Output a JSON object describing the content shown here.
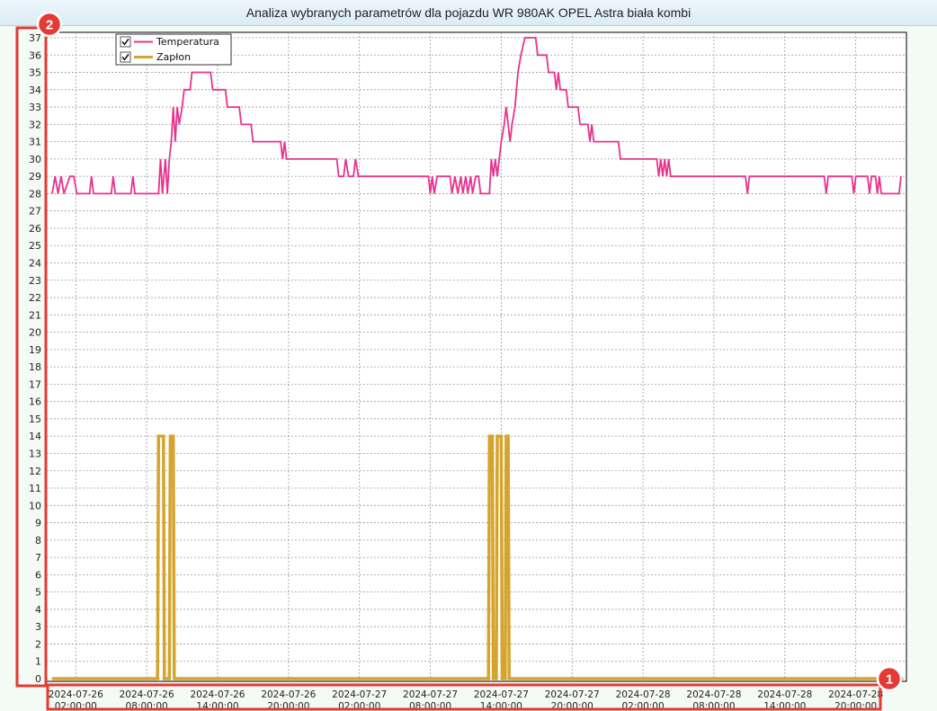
{
  "window": {
    "title": "Analiza wybranych parametrów dla pojazdu WR 980AK OPEL Astra biała kombi"
  },
  "annotations": {
    "x_axis_marker": "1",
    "y_axis_marker": "2"
  },
  "colors": {
    "temperatura": "#e8338f",
    "zaplon": "#d4a42c",
    "marker": "#e53935"
  },
  "chart_data": {
    "type": "line",
    "title": "",
    "xlabel": "",
    "ylabel": "",
    "ylim": [
      0,
      37
    ],
    "y_ticks": [
      0,
      1,
      2,
      3,
      4,
      5,
      6,
      7,
      8,
      9,
      10,
      11,
      12,
      13,
      14,
      15,
      16,
      17,
      18,
      19,
      20,
      21,
      22,
      23,
      24,
      25,
      26,
      27,
      28,
      29,
      30,
      31,
      32,
      33,
      34,
      35,
      36,
      37
    ],
    "x_range": [
      "2024-07-26 00:00:00",
      "2024-07-28 23:59:00"
    ],
    "x_ticks": [
      {
        "date": "2024-07-26",
        "time": "02:00:00"
      },
      {
        "date": "2024-07-26",
        "time": "08:00:00"
      },
      {
        "date": "2024-07-26",
        "time": "14:00:00"
      },
      {
        "date": "2024-07-26",
        "time": "20:00:00"
      },
      {
        "date": "2024-07-27",
        "time": "02:00:00"
      },
      {
        "date": "2024-07-27",
        "time": "08:00:00"
      },
      {
        "date": "2024-07-27",
        "time": "14:00:00"
      },
      {
        "date": "2024-07-27",
        "time": "20:00:00"
      },
      {
        "date": "2024-07-28",
        "time": "02:00:00"
      },
      {
        "date": "2024-07-28",
        "time": "08:00:00"
      },
      {
        "date": "2024-07-28",
        "time": "14:00:00"
      },
      {
        "date": "2024-07-28",
        "time": "20:00:00"
      }
    ],
    "grid": true,
    "legend": "top-left",
    "series": [
      {
        "name": "Temperatura",
        "checked": true,
        "points": [
          [
            "2024-07-26 00:00",
            28
          ],
          [
            "2024-07-26 00:15",
            29
          ],
          [
            "2024-07-26 00:30",
            28
          ],
          [
            "2024-07-26 00:45",
            29
          ],
          [
            "2024-07-26 01:00",
            28
          ],
          [
            "2024-07-26 01:30",
            29
          ],
          [
            "2024-07-26 01:50",
            29
          ],
          [
            "2024-07-26 02:05",
            28
          ],
          [
            "2024-07-26 03:10",
            28
          ],
          [
            "2024-07-26 03:20",
            29
          ],
          [
            "2024-07-26 03:30",
            28
          ],
          [
            "2024-07-26 05:00",
            28
          ],
          [
            "2024-07-26 05:10",
            29
          ],
          [
            "2024-07-26 05:20",
            28
          ],
          [
            "2024-07-26 06:40",
            28
          ],
          [
            "2024-07-26 06:50",
            29
          ],
          [
            "2024-07-26 07:00",
            28
          ],
          [
            "2024-07-26 09:00",
            28
          ],
          [
            "2024-07-26 09:10",
            30
          ],
          [
            "2024-07-26 09:20",
            28
          ],
          [
            "2024-07-26 09:35",
            30
          ],
          [
            "2024-07-26 09:45",
            28
          ],
          [
            "2024-07-26 09:55",
            30
          ],
          [
            "2024-07-26 10:05",
            31
          ],
          [
            "2024-07-26 10:15",
            33
          ],
          [
            "2024-07-26 10:25",
            31
          ],
          [
            "2024-07-26 10:35",
            33
          ],
          [
            "2024-07-26 10:45",
            32
          ],
          [
            "2024-07-26 11:00",
            33
          ],
          [
            "2024-07-26 11:10",
            34
          ],
          [
            "2024-07-26 11:40",
            34
          ],
          [
            "2024-07-26 11:50",
            35
          ],
          [
            "2024-07-26 13:25",
            35
          ],
          [
            "2024-07-26 13:35",
            34
          ],
          [
            "2024-07-26 14:40",
            34
          ],
          [
            "2024-07-26 14:50",
            33
          ],
          [
            "2024-07-26 15:50",
            33
          ],
          [
            "2024-07-26 16:00",
            32
          ],
          [
            "2024-07-26 16:50",
            32
          ],
          [
            "2024-07-26 17:00",
            31
          ],
          [
            "2024-07-26 19:20",
            31
          ],
          [
            "2024-07-26 19:30",
            30
          ],
          [
            "2024-07-26 19:40",
            31
          ],
          [
            "2024-07-26 19:50",
            30
          ],
          [
            "2024-07-27 00:05",
            30
          ],
          [
            "2024-07-27 00:15",
            29
          ],
          [
            "2024-07-27 00:40",
            29
          ],
          [
            "2024-07-27 00:50",
            30
          ],
          [
            "2024-07-27 01:05",
            29
          ],
          [
            "2024-07-27 01:30",
            29
          ],
          [
            "2024-07-27 01:40",
            30
          ],
          [
            "2024-07-27 01:55",
            29
          ],
          [
            "2024-07-27 07:50",
            29
          ],
          [
            "2024-07-27 08:00",
            28
          ],
          [
            "2024-07-27 08:10",
            29
          ],
          [
            "2024-07-27 08:20",
            28
          ],
          [
            "2024-07-27 08:35",
            29
          ],
          [
            "2024-07-27 09:40",
            29
          ],
          [
            "2024-07-27 09:50",
            28
          ],
          [
            "2024-07-27 10:05",
            29
          ],
          [
            "2024-07-27 10:20",
            28
          ],
          [
            "2024-07-27 10:35",
            29
          ],
          [
            "2024-07-27 10:45",
            28
          ],
          [
            "2024-07-27 11:00",
            29
          ],
          [
            "2024-07-27 11:10",
            28
          ],
          [
            "2024-07-27 11:25",
            29
          ],
          [
            "2024-07-27 11:35",
            28
          ],
          [
            "2024-07-27 11:50",
            29
          ],
          [
            "2024-07-27 12:05",
            29
          ],
          [
            "2024-07-27 12:15",
            28
          ],
          [
            "2024-07-27 13:00",
            28
          ],
          [
            "2024-07-27 13:10",
            30
          ],
          [
            "2024-07-27 13:20",
            29
          ],
          [
            "2024-07-27 13:30",
            30
          ],
          [
            "2024-07-27 13:40",
            29
          ],
          [
            "2024-07-27 13:50",
            30
          ],
          [
            "2024-07-27 14:00",
            31
          ],
          [
            "2024-07-27 14:15",
            32
          ],
          [
            "2024-07-27 14:25",
            33
          ],
          [
            "2024-07-27 14:35",
            32
          ],
          [
            "2024-07-27 14:45",
            31
          ],
          [
            "2024-07-27 14:55",
            32
          ],
          [
            "2024-07-27 15:10",
            33
          ],
          [
            "2024-07-27 15:25",
            35
          ],
          [
            "2024-07-27 15:40",
            36
          ],
          [
            "2024-07-27 16:00",
            37
          ],
          [
            "2024-07-27 16:55",
            37
          ],
          [
            "2024-07-27 17:05",
            36
          ],
          [
            "2024-07-27 17:50",
            36
          ],
          [
            "2024-07-27 18:00",
            35
          ],
          [
            "2024-07-27 18:30",
            35
          ],
          [
            "2024-07-27 18:40",
            34
          ],
          [
            "2024-07-27 18:50",
            35
          ],
          [
            "2024-07-27 19:00",
            34
          ],
          [
            "2024-07-27 19:30",
            34
          ],
          [
            "2024-07-27 19:40",
            33
          ],
          [
            "2024-07-27 20:30",
            33
          ],
          [
            "2024-07-27 20:40",
            32
          ],
          [
            "2024-07-27 21:20",
            32
          ],
          [
            "2024-07-27 21:30",
            31
          ],
          [
            "2024-07-27 21:40",
            32
          ],
          [
            "2024-07-27 21:50",
            31
          ],
          [
            "2024-07-27 23:55",
            31
          ],
          [
            "2024-07-28 00:05",
            30
          ],
          [
            "2024-07-28 03:10",
            30
          ],
          [
            "2024-07-28 03:20",
            29
          ],
          [
            "2024-07-28 03:30",
            30
          ],
          [
            "2024-07-28 03:40",
            29
          ],
          [
            "2024-07-28 03:50",
            30
          ],
          [
            "2024-07-28 04:00",
            29
          ],
          [
            "2024-07-28 04:10",
            30
          ],
          [
            "2024-07-28 04:20",
            29
          ],
          [
            "2024-07-28 10:40",
            29
          ],
          [
            "2024-07-28 10:50",
            28
          ],
          [
            "2024-07-28 11:00",
            29
          ],
          [
            "2024-07-28 17:20",
            29
          ],
          [
            "2024-07-28 17:30",
            28
          ],
          [
            "2024-07-28 17:40",
            29
          ],
          [
            "2024-07-28 19:40",
            29
          ],
          [
            "2024-07-28 19:50",
            28
          ],
          [
            "2024-07-28 20:00",
            29
          ],
          [
            "2024-07-28 21:00",
            29
          ],
          [
            "2024-07-28 21:10",
            28
          ],
          [
            "2024-07-28 21:20",
            29
          ],
          [
            "2024-07-28 21:40",
            29
          ],
          [
            "2024-07-28 21:50",
            28
          ],
          [
            "2024-07-28 22:00",
            29
          ],
          [
            "2024-07-28 22:10",
            28
          ],
          [
            "2024-07-28 23:40",
            28
          ],
          [
            "2024-07-28 23:50",
            29
          ]
        ]
      },
      {
        "name": "Zapłon",
        "checked": true,
        "points": [
          [
            "2024-07-26 00:00",
            0
          ],
          [
            "2024-07-26 08:55",
            0
          ],
          [
            "2024-07-26 09:00",
            14
          ],
          [
            "2024-07-26 09:25",
            14
          ],
          [
            "2024-07-26 09:30",
            0
          ],
          [
            "2024-07-26 09:55",
            0
          ],
          [
            "2024-07-26 10:00",
            14
          ],
          [
            "2024-07-26 10:15",
            14
          ],
          [
            "2024-07-26 10:20",
            0
          ],
          [
            "2024-07-27 12:55",
            0
          ],
          [
            "2024-07-27 13:00",
            14
          ],
          [
            "2024-07-27 13:15",
            14
          ],
          [
            "2024-07-27 13:20",
            0
          ],
          [
            "2024-07-27 13:35",
            0
          ],
          [
            "2024-07-27 13:40",
            14
          ],
          [
            "2024-07-27 14:00",
            14
          ],
          [
            "2024-07-27 14:05",
            0
          ],
          [
            "2024-07-27 14:20",
            0
          ],
          [
            "2024-07-27 14:25",
            14
          ],
          [
            "2024-07-27 14:35",
            14
          ],
          [
            "2024-07-27 14:40",
            0
          ],
          [
            "2024-07-28 23:59",
            0
          ]
        ]
      }
    ]
  }
}
